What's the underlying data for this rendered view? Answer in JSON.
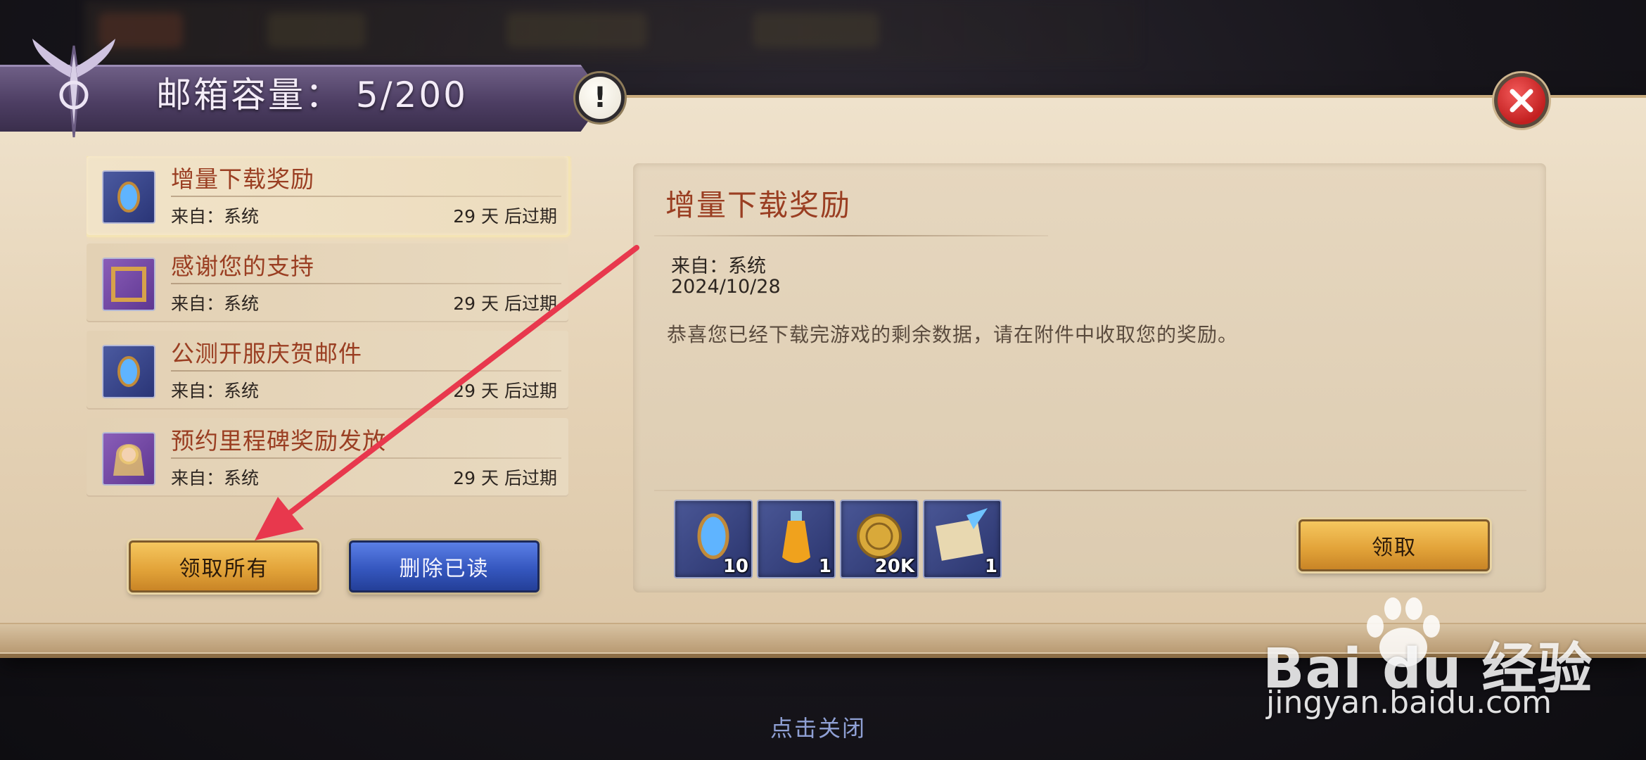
{
  "header": {
    "title": "邮箱容量：  5/200",
    "info_symbol": "!"
  },
  "mails": [
    {
      "title": "增量下载奖励",
      "from": "来自：系统",
      "expire": "29 天 后过期",
      "icon": "blue-gem-icon",
      "selected": true
    },
    {
      "title": "感谢您的支持",
      "from": "来自：系统",
      "expire": "29 天 后过期",
      "icon": "purple-frame-icon",
      "selected": false
    },
    {
      "title": "公测开服庆贺邮件",
      "from": "来自：系统",
      "expire": "29 天 后过期",
      "icon": "blue-gem-icon",
      "selected": false
    },
    {
      "title": "预约里程碑奖励发放",
      "from": "来自：系统",
      "expire": "29 天 后过期",
      "icon": "hero-portrait-icon",
      "selected": false
    }
  ],
  "buttons": {
    "claim_all": "领取所有",
    "delete_read": "删除已读",
    "claim": "领取"
  },
  "detail": {
    "title": "增量下载奖励",
    "from": "来自：系统",
    "date": "2024/10/28",
    "body": "恭喜您已经下载完游戏的剩余数据，请在附件中收取您的奖励。",
    "attachments": [
      {
        "icon": "blue-gem-icon",
        "count": "10"
      },
      {
        "icon": "potion-icon",
        "count": "1"
      },
      {
        "icon": "gold-coin-icon",
        "count": "20K"
      },
      {
        "icon": "scroll-quill-icon",
        "count": "1"
      }
    ]
  },
  "footer": {
    "close_hint": "点击关闭"
  },
  "watermark": {
    "brand": "Bai du 经验",
    "url": "jingyan.baidu.com"
  },
  "colors": {
    "title_red": "#9a3e22",
    "gold_button": "#e3a43a",
    "blue_button": "#3557bf",
    "close_red": "#c22020",
    "annotation_arrow": "#e8384d"
  }
}
